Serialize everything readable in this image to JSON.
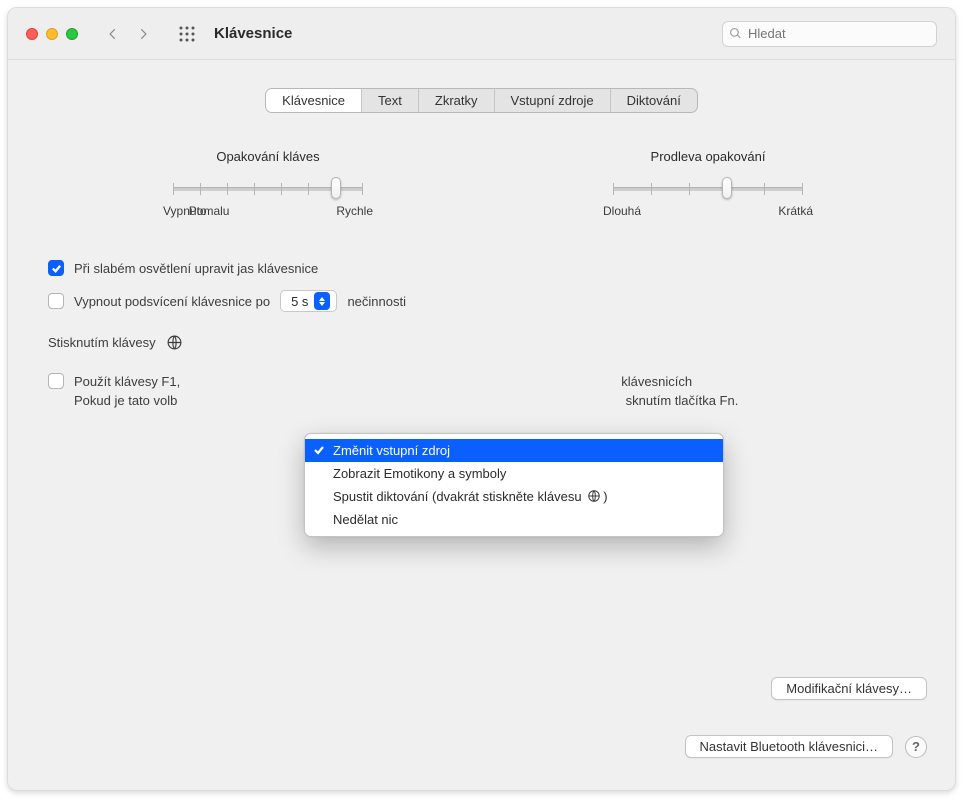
{
  "window": {
    "title": "Klávesnice"
  },
  "search": {
    "placeholder": "Hledat"
  },
  "tabs": [
    {
      "label": "Klávesnice",
      "active": true
    },
    {
      "label": "Text"
    },
    {
      "label": "Zkratky"
    },
    {
      "label": "Vstupní zdroje"
    },
    {
      "label": "Diktování"
    }
  ],
  "sliders": {
    "repeat": {
      "title": "Opakování kláves",
      "ticks": 8,
      "value_index": 6,
      "labels": {
        "left": "Vypnuto",
        "mid": "Pomalu",
        "right": "Rychle"
      }
    },
    "delay": {
      "title": "Prodleva opakování",
      "ticks": 6,
      "value_index": 3,
      "labels": {
        "left": "Dlouhá",
        "right": "Krátká"
      }
    }
  },
  "options": {
    "adjust_brightness": {
      "checked": true,
      "label": "Při slabém osvětlení upravit jas klávesnice"
    },
    "turn_off_backlight": {
      "checked": false,
      "label_before": "Vypnout podsvícení klávesnice po",
      "select_value": "5 s",
      "label_after": "nečinnosti"
    },
    "press_key": {
      "label_before": "Stisknutím klávesy"
    },
    "fn_keys": {
      "checked": false,
      "label_line1_begin": "Použít klávesy F1,",
      "label_line1_end": " klávesnicích",
      "hint_begin": "Pokud je tato volb",
      "hint_end": "sknutím tlačítka Fn."
    }
  },
  "popup": {
    "items": [
      {
        "label": "Změnit vstupní zdroj",
        "selected": true
      },
      {
        "label": "Zobrazit Emotikony a symboly"
      },
      {
        "label_pre": "Spustit diktování (dvakrát stiskněte klávesu ",
        "label_post": ")",
        "has_globe": true
      },
      {
        "label": "Nedělat nic"
      }
    ]
  },
  "footer": {
    "modifier_keys": "Modifikační klávesy…",
    "bluetooth": "Nastavit Bluetooth klávesnici…",
    "help": "?"
  }
}
